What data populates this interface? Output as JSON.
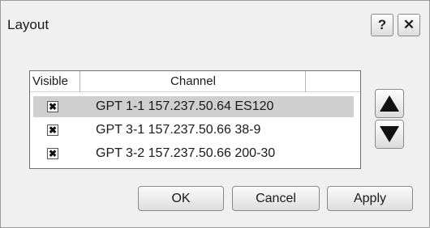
{
  "dialog": {
    "title": "Layout",
    "help_label": "?",
    "close_label": "✕"
  },
  "list": {
    "columns": {
      "visible": "Visible",
      "channel": "Channel"
    },
    "rows": [
      {
        "checked": true,
        "check_glyph": "✖",
        "label": "GPT 1-1 157.237.50.64 ES120",
        "selected": true
      },
      {
        "checked": true,
        "check_glyph": "✖",
        "label": "GPT 3-1 157.237.50.66 38-9",
        "selected": false
      },
      {
        "checked": true,
        "check_glyph": "✖",
        "label": "GPT 3-2 157.237.50.66 200-30",
        "selected": false
      }
    ]
  },
  "reorder": {
    "up_icon": "arrow-up-icon",
    "down_icon": "arrow-down-icon"
  },
  "buttons": {
    "ok": "OK",
    "cancel": "Cancel",
    "apply": "Apply"
  },
  "colors": {
    "selected_row": "#cfcfcf",
    "background": "#f0f0f0"
  }
}
